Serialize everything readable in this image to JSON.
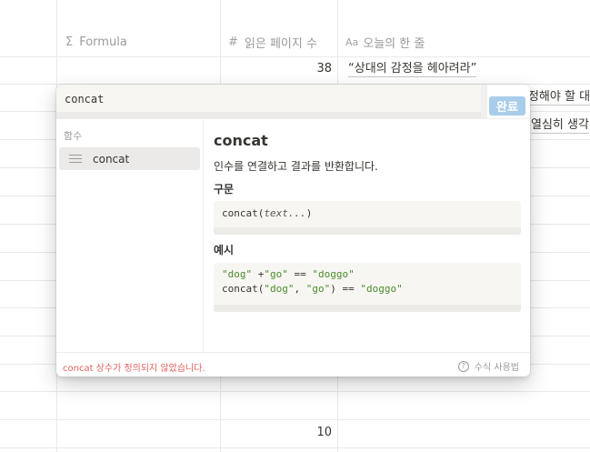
{
  "table": {
    "columns": [
      {
        "icon": "sigma-icon",
        "glyph": "Σ",
        "label": "Formula"
      },
      {
        "icon": "number-icon",
        "glyph": "#",
        "label": "읽은 페이지 수"
      },
      {
        "icon": "text-icon",
        "glyph": "Aa",
        "label": "오늘의 한 줄"
      }
    ],
    "rows": [
      {
        "pages": "38",
        "quote": "“상대의 감정을 헤아려라”"
      },
      {
        "pages": "",
        "quote": "…걱정해야 할 대"
      },
      {
        "pages": "",
        "quote": "열심히 생각"
      },
      {
        "pages": "10",
        "quote": ""
      }
    ]
  },
  "popup": {
    "formula_input": "concat",
    "done_label": "완료",
    "sidebar": {
      "heading": "함수",
      "items": [
        {
          "label": "concat",
          "icon": "text-lines-icon",
          "selected": true
        }
      ]
    },
    "doc": {
      "title": "concat",
      "description": "인수를 연결하고 결과를 반환합니다.",
      "syntax_heading": "구문",
      "syntax_fn": "concat(",
      "syntax_arg": "text...",
      "syntax_close": ")",
      "example_heading": "예시",
      "example_lines": [
        [
          "\"dog\"",
          " +",
          "\"go\"",
          " == ",
          "\"doggo\""
        ],
        [
          "concat(",
          "\"dog\"",
          ", ",
          "\"go\"",
          ") == ",
          "\"doggo\""
        ]
      ]
    },
    "footer": {
      "error": "concat 상수가 정의되지 않았습니다.",
      "help_label": "수식 사용법",
      "help_icon": "question-circle-icon"
    }
  },
  "colors": {
    "accent_button": "#a8cdea",
    "error": "#e0625d",
    "string": "#4a8c2a",
    "muted": "#9b9a97"
  }
}
